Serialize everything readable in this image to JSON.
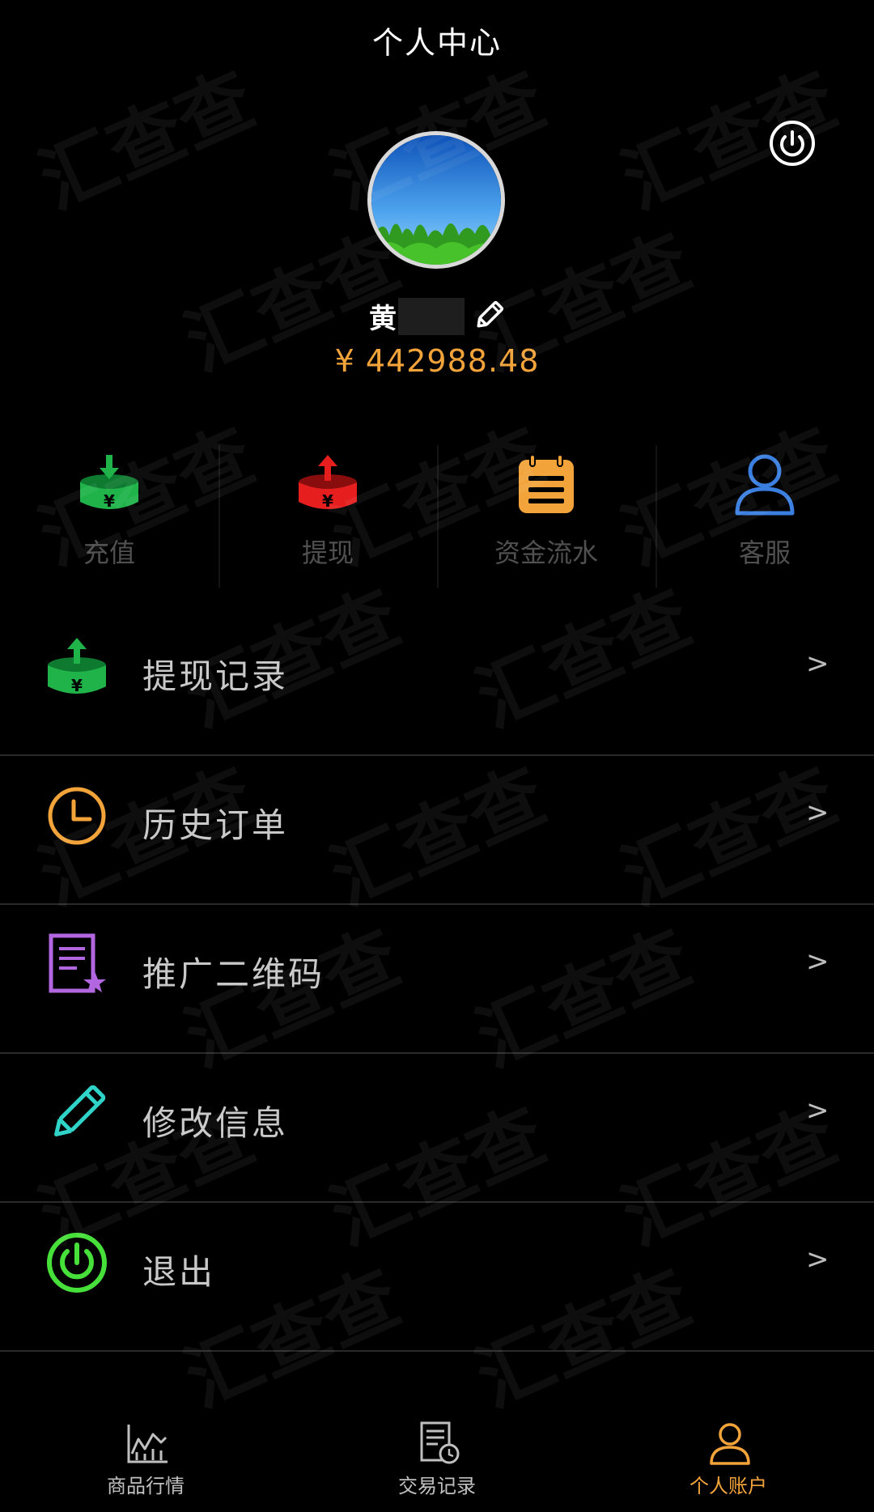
{
  "header": {
    "title": "个人中心"
  },
  "profile": {
    "name": "黄",
    "balance": "¥ 442988.48"
  },
  "quick_actions": [
    {
      "label": "充值",
      "icon": "deposit-icon"
    },
    {
      "label": "提现",
      "icon": "withdraw-icon"
    },
    {
      "label": "资金流水",
      "icon": "notepad-icon"
    },
    {
      "label": "客服",
      "icon": "person-icon"
    }
  ],
  "menu": [
    {
      "label": "提现记录",
      "icon": "withdraw-record-icon",
      "arrow": ">"
    },
    {
      "label": "历史订单",
      "icon": "clock-icon",
      "arrow": ">"
    },
    {
      "label": "推广二维码",
      "icon": "document-star-icon",
      "arrow": ">"
    },
    {
      "label": "修改信息",
      "icon": "pencil-icon",
      "arrow": ">"
    },
    {
      "label": "退出",
      "icon": "power-icon",
      "arrow": ">"
    }
  ],
  "bottom_nav": [
    {
      "label": "商品行情",
      "icon": "chart-icon"
    },
    {
      "label": "交易记录",
      "icon": "receipt-icon"
    },
    {
      "label": "个人账户",
      "icon": "user-icon",
      "active": true
    }
  ],
  "watermark": "汇查查",
  "colors": {
    "accent": "#f2a33a",
    "background": "#000000",
    "green": "#1fb34a",
    "red": "#e61e1e",
    "blue": "#3a7fe0",
    "purple": "#b266e0",
    "cyan": "#2fd3c8",
    "lime": "#47e03a"
  }
}
